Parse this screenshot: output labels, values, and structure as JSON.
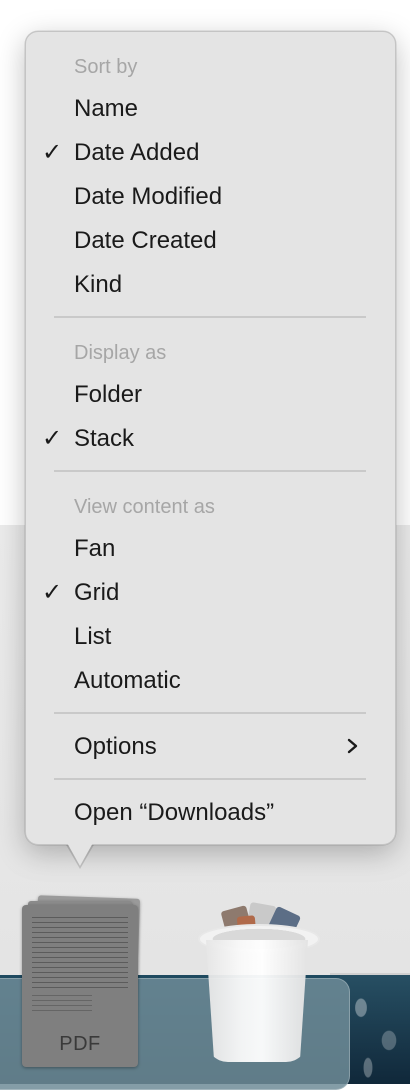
{
  "menu": {
    "sort_by": {
      "header": "Sort by",
      "items": [
        {
          "label": "Name",
          "checked": false
        },
        {
          "label": "Date Added",
          "checked": true
        },
        {
          "label": "Date Modified",
          "checked": false
        },
        {
          "label": "Date Created",
          "checked": false
        },
        {
          "label": "Kind",
          "checked": false
        }
      ]
    },
    "display_as": {
      "header": "Display as",
      "items": [
        {
          "label": "Folder",
          "checked": false
        },
        {
          "label": "Stack",
          "checked": true
        }
      ]
    },
    "view_content_as": {
      "header": "View content as",
      "items": [
        {
          "label": "Fan",
          "checked": false
        },
        {
          "label": "Grid",
          "checked": true
        },
        {
          "label": "List",
          "checked": false
        },
        {
          "label": "Automatic",
          "checked": false
        }
      ]
    },
    "options": {
      "label": "Options",
      "has_submenu": true
    },
    "open": {
      "label": "Open “Downloads”"
    },
    "check_glyph": "✓"
  },
  "dock": {
    "stack_label": "PDF",
    "icons": [
      "pdf-stack-icon",
      "trash-icon"
    ]
  },
  "colors": {
    "menu_bg": "#e4e4e4",
    "header_text": "#a6a6a6",
    "item_text": "#1a1a1a",
    "dock_bg": "#6e8c98"
  }
}
